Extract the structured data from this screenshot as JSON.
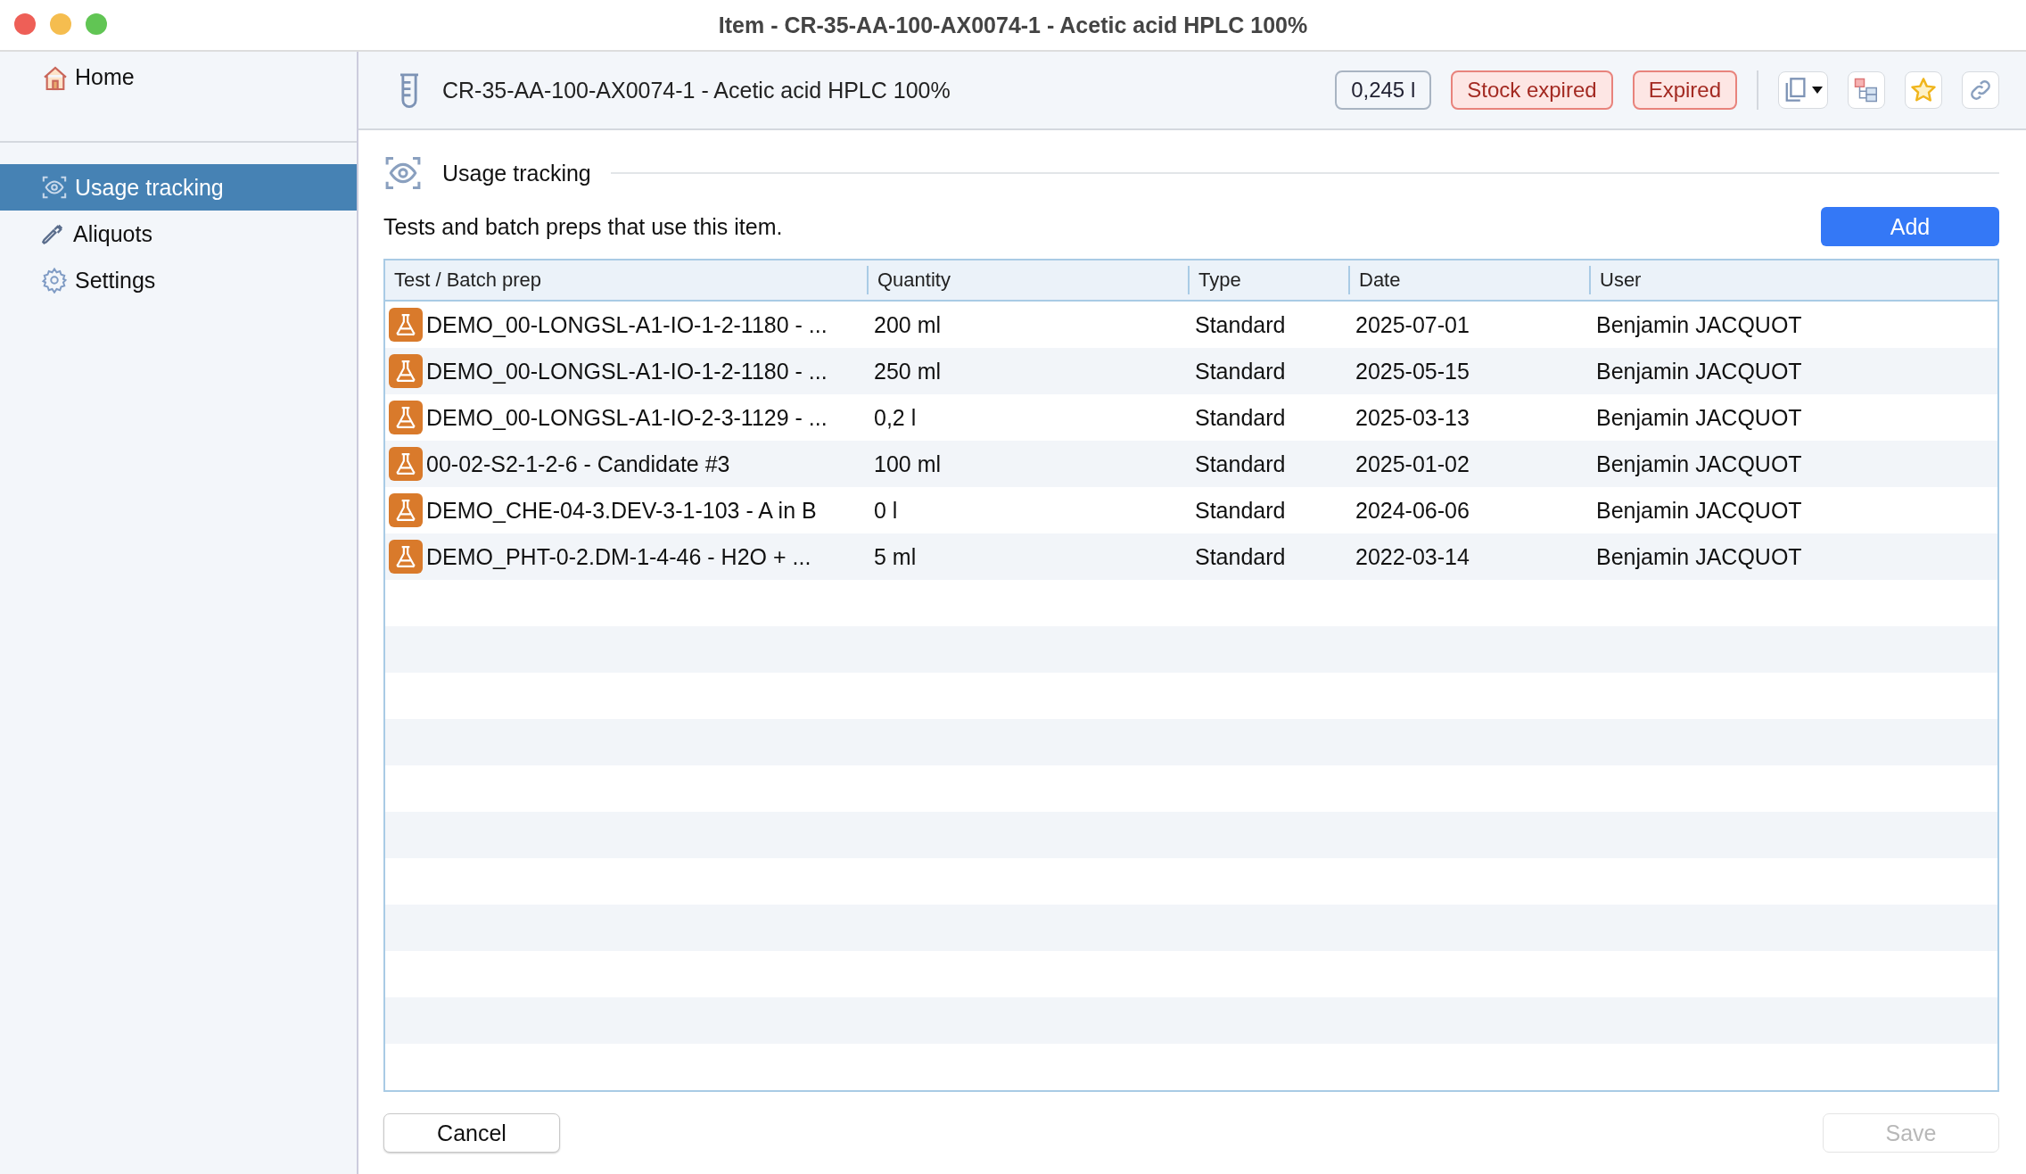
{
  "window": {
    "title": "Item - CR-35-AA-100-AX0074-1 - Acetic acid HPLC 100%"
  },
  "sidebar": {
    "home": {
      "label": "Home"
    },
    "items": [
      {
        "label": "Usage tracking",
        "selected": true
      },
      {
        "label": "Aliquots",
        "selected": false
      },
      {
        "label": "Settings",
        "selected": false
      }
    ]
  },
  "header": {
    "title": "CR-35-AA-100-AX0074-1 - Acetic acid HPLC 100%",
    "quantity": "0,245 l",
    "badges": [
      "Stock expired",
      "Expired"
    ]
  },
  "section": {
    "title": "Usage tracking",
    "description": "Tests and batch preps that use this item.",
    "add_button": "Add"
  },
  "table": {
    "columns": [
      "Test / Batch prep",
      "Quantity",
      "Type",
      "Date",
      "User"
    ],
    "rows": [
      [
        "DEMO_00-LONGSL-A1-IO-1-2-1180 - ...",
        "200 ml",
        "Standard",
        "2025-07-01",
        "Benjamin JACQUOT"
      ],
      [
        "DEMO_00-LONGSL-A1-IO-1-2-1180 - ...",
        "250 ml",
        "Standard",
        "2025-05-15",
        "Benjamin JACQUOT"
      ],
      [
        "DEMO_00-LONGSL-A1-IO-2-3-1129 - ...",
        "0,2 l",
        "Standard",
        "2025-03-13",
        "Benjamin JACQUOT"
      ],
      [
        "00-02-S2-1-2-6 - Candidate #3",
        "100 ml",
        "Standard",
        "2025-01-02",
        "Benjamin JACQUOT"
      ],
      [
        "DEMO_CHE-04-3.DEV-3-1-103 - A in B",
        "0 l",
        "Standard",
        "2024-06-06",
        "Benjamin JACQUOT"
      ],
      [
        "DEMO_PHT-0-2.DM-1-4-46 - H2O + ...",
        "5 ml",
        "Standard",
        "2022-03-14",
        "Benjamin JACQUOT"
      ]
    ]
  },
  "footer": {
    "cancel": {
      "label": "Cancel",
      "disabled": false
    },
    "save": {
      "label": "Save",
      "disabled": true
    }
  }
}
